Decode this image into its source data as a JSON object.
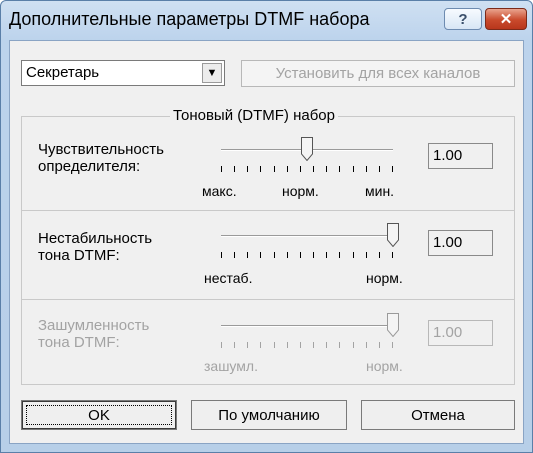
{
  "window": {
    "title": "Дополнительные параметры DTMF набора",
    "help_label": "?",
    "close_label": "✕"
  },
  "profile": {
    "selected": "Секретарь",
    "arrow": "▼"
  },
  "set_all_button": "Установить для всех каналов",
  "group": {
    "legend": "Тоновый (DTMF) набор",
    "params": [
      {
        "label_line1": "Чувствительность",
        "label_line2": "определителя:",
        "value": "1.00",
        "left_mark": "макс.",
        "mid_mark": "норм.",
        "right_mark": "мин.",
        "position": 0.5,
        "enabled": true
      },
      {
        "label_line1": "Нестабильность",
        "label_line2": "тона DTMF:",
        "value": "1.00",
        "left_mark": "нестаб.",
        "right_mark": "норм.",
        "position": 1.0,
        "enabled": true
      },
      {
        "label_line1": "Зашумленность",
        "label_line2": "тона DTMF:",
        "value": "1.00",
        "left_mark": "зашумл.",
        "right_mark": "норм.",
        "position": 1.0,
        "enabled": false
      }
    ]
  },
  "buttons": {
    "ok": "OK",
    "defaults": "По умолчанию",
    "cancel": "Отмена"
  }
}
